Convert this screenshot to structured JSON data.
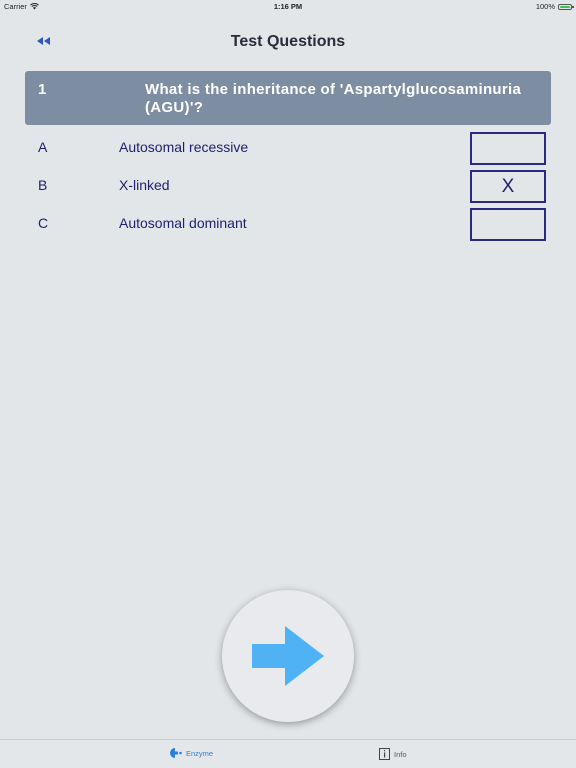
{
  "status_bar": {
    "carrier": "Carrier",
    "time": "1:16 PM",
    "battery": "100%"
  },
  "nav": {
    "back_icon": "rewind-icon",
    "title": "Test Questions"
  },
  "question": {
    "number": "1",
    "text": "What is the inheritance of 'Aspartylglucosaminuria (AGU)'?"
  },
  "answers": [
    {
      "letter": "A",
      "text": "Autosomal recessive",
      "mark": ""
    },
    {
      "letter": "B",
      "text": "X-linked",
      "mark": "X"
    },
    {
      "letter": "C",
      "text": "Autosomal dominant",
      "mark": ""
    }
  ],
  "next_button": {
    "icon": "arrow-right-icon"
  },
  "tabs": [
    {
      "label": "Enzyme",
      "icon": "enzyme-icon",
      "selected": true
    },
    {
      "label": "Info",
      "icon": "info-icon",
      "selected": false
    }
  ],
  "colors": {
    "background": "#e2e6e9",
    "header": "#7d8ea3",
    "text": "#1f1f6b",
    "arrow": "#4eb2f5",
    "tab_active": "#2a7fd6"
  }
}
